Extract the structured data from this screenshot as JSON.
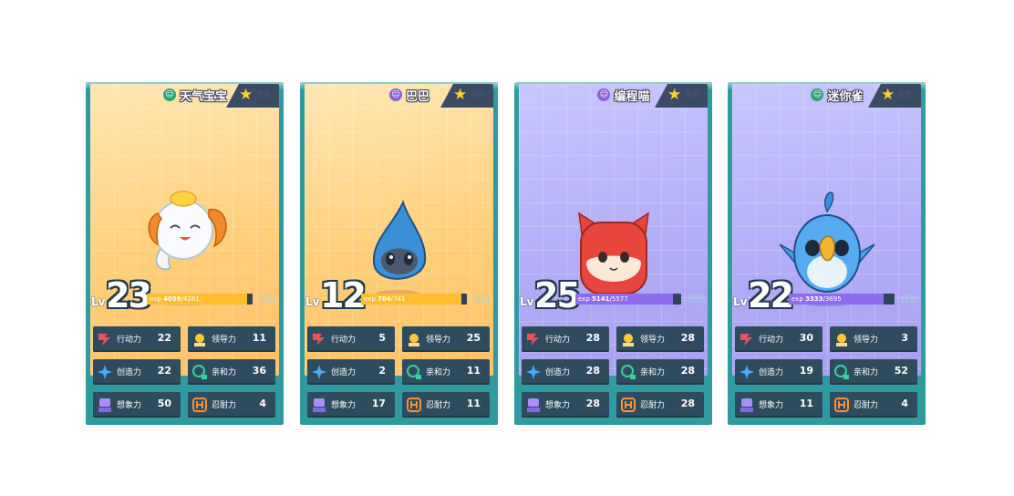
{
  "cards": [
    {
      "name": "天气宝宝",
      "element_icon": "element-green-icon",
      "theme": "orange",
      "level": "23",
      "exp_current": "4059",
      "exp_total": "/4281",
      "exp_fraction": 0.95,
      "exp_label": "经验",
      "stats": [
        {
          "label": "行动力",
          "value": "22",
          "icon": "action-icon"
        },
        {
          "label": "领导力",
          "value": "11",
          "icon": "leadership-icon"
        },
        {
          "label": "创造力",
          "value": "22",
          "icon": "creativity-icon"
        },
        {
          "label": "亲和力",
          "value": "36",
          "icon": "affinity-icon"
        },
        {
          "label": "想象力",
          "value": "50",
          "icon": "imagination-icon"
        },
        {
          "label": "忍耐力",
          "value": "4",
          "icon": "endurance-icon"
        }
      ]
    },
    {
      "name": "巴巴",
      "element_icon": "element-purple-icon",
      "theme": "orange",
      "level": "12",
      "exp_current": "704",
      "exp_total": "/741",
      "exp_fraction": 0.95,
      "exp_label": "经验",
      "stats": [
        {
          "label": "行动力",
          "value": "5",
          "icon": "action-icon"
        },
        {
          "label": "领导力",
          "value": "25",
          "icon": "leadership-icon"
        },
        {
          "label": "创造力",
          "value": "2",
          "icon": "creativity-icon"
        },
        {
          "label": "亲和力",
          "value": "11",
          "icon": "affinity-icon"
        },
        {
          "label": "想象力",
          "value": "17",
          "icon": "imagination-icon"
        },
        {
          "label": "忍耐力",
          "value": "11",
          "icon": "endurance-icon"
        }
      ]
    },
    {
      "name": "编程喵",
      "element_icon": "element-purple-icon",
      "theme": "purple",
      "level": "25",
      "exp_current": "5141",
      "exp_total": "/5577",
      "exp_fraction": 0.92,
      "exp_label": "经验",
      "stats": [
        {
          "label": "行动力",
          "value": "28",
          "icon": "action-icon"
        },
        {
          "label": "领导力",
          "value": "28",
          "icon": "leadership-icon"
        },
        {
          "label": "创造力",
          "value": "28",
          "icon": "creativity-icon"
        },
        {
          "label": "亲和力",
          "value": "28",
          "icon": "affinity-icon"
        },
        {
          "label": "想象力",
          "value": "28",
          "icon": "imagination-icon"
        },
        {
          "label": "忍耐力",
          "value": "28",
          "icon": "endurance-icon"
        }
      ]
    },
    {
      "name": "迷你雀",
      "element_icon": "element-green-icon",
      "theme": "purple",
      "level": "22",
      "exp_current": "3333",
      "exp_total": "/3695",
      "exp_fraction": 0.9,
      "exp_label": "经验",
      "stats": [
        {
          "label": "行动力",
          "value": "30",
          "icon": "action-icon"
        },
        {
          "label": "领导力",
          "value": "3",
          "icon": "leadership-icon"
        },
        {
          "label": "创造力",
          "value": "19",
          "icon": "creativity-icon"
        },
        {
          "label": "亲和力",
          "value": "52",
          "icon": "affinity-icon"
        },
        {
          "label": "想象力",
          "value": "11",
          "icon": "imagination-icon"
        },
        {
          "label": "忍耐力",
          "value": "4",
          "icon": "endurance-icon"
        }
      ]
    }
  ],
  "colors": {
    "card_frame": "#2f9a9f",
    "stat_box": "#2f4c5e",
    "exp_gold": "#ffbe2e",
    "exp_violet": "#8d6cf0",
    "star": "#ffcf2e"
  }
}
